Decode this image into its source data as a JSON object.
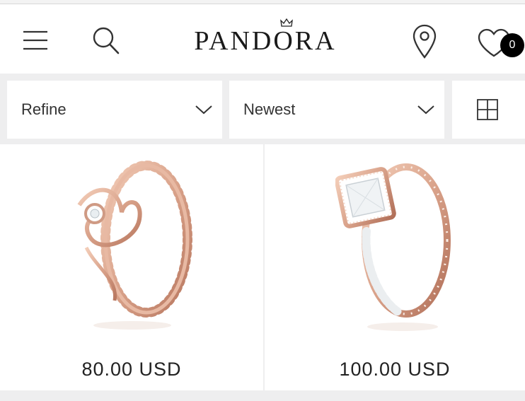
{
  "header": {
    "brand": "PANDORA",
    "wishlist_count": "0",
    "icons": [
      "menu-icon",
      "search-icon",
      "crown-icon",
      "location-pin-icon",
      "heart-icon"
    ]
  },
  "filters": {
    "refine_label": "Refine",
    "sort_label": "Newest",
    "icons": [
      "chevron-down-icon",
      "grid-view-icon"
    ]
  },
  "products": [
    {
      "price": "80.00 USD",
      "image": "rose-gold-princess-tiara-ring"
    },
    {
      "price": "100.00 USD",
      "image": "rose-gold-square-sparkle-halo-ring"
    }
  ],
  "colors": {
    "page_background": "#eeeeef",
    "card_background": "#ffffff",
    "rose_gold": "#d9a28a",
    "badge": "#000000"
  }
}
